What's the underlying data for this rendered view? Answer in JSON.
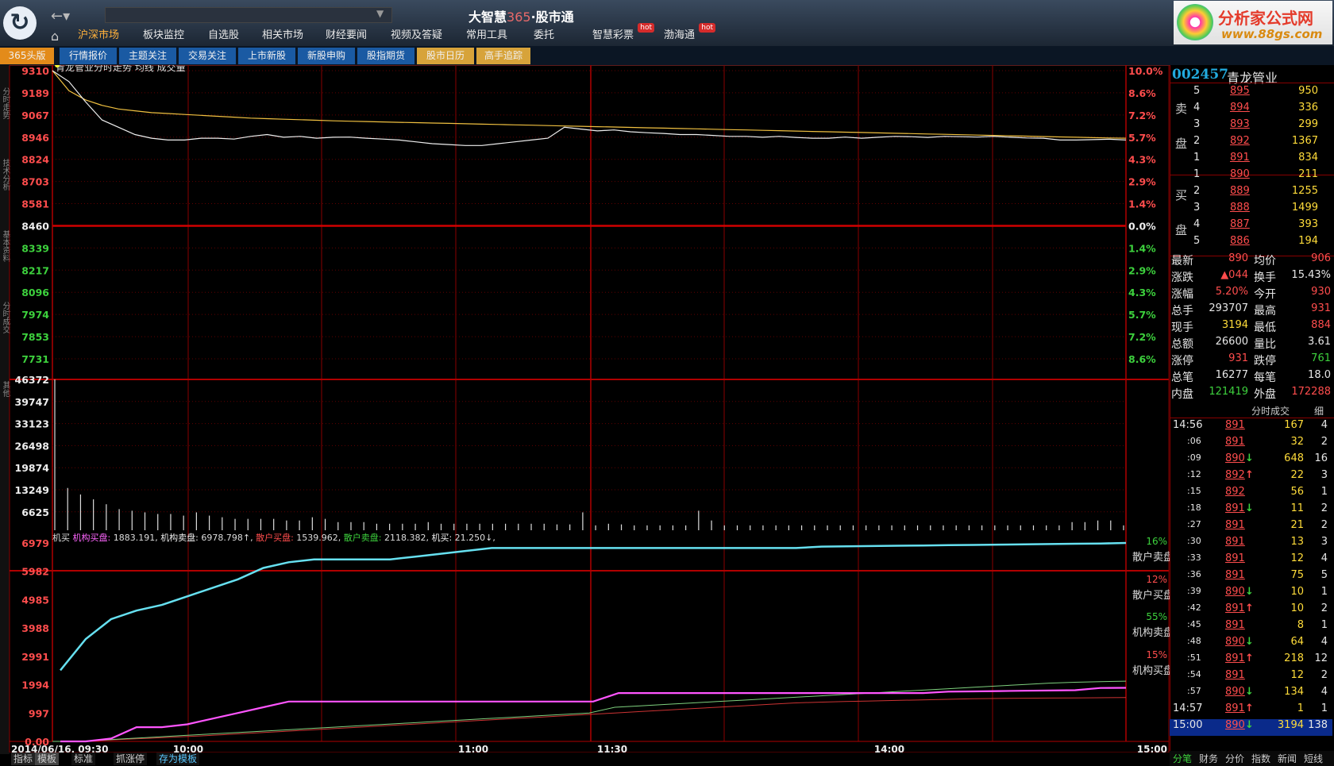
{
  "app": {
    "title_a": "大智慧",
    "title_b": "365",
    "title_c": "·",
    "title_d": "股市通",
    "back_icon": "arrow-left-icon",
    "home_icon": "home-icon"
  },
  "top_menu": [
    {
      "label": "沪深市场",
      "active": true
    },
    {
      "label": "板块监控"
    },
    {
      "label": "自选股"
    },
    {
      "label": "相关市场"
    },
    {
      "label": "财经要闻"
    },
    {
      "label": "视频及答疑"
    },
    {
      "label": "常用工具"
    },
    {
      "label": "委托"
    },
    {
      "label": "智慧彩票",
      "hot": "hot"
    },
    {
      "label": "渤海通",
      "hot": "hot"
    }
  ],
  "brand": {
    "name": "分析家公式网",
    "url": "www.88gs.com"
  },
  "sub_tabs": [
    {
      "label": "365头版",
      "style": "orange"
    },
    {
      "label": "行情报价"
    },
    {
      "label": "主题关注"
    },
    {
      "label": "交易关注"
    },
    {
      "label": "上市新股"
    },
    {
      "label": "新股申购"
    },
    {
      "label": "股指期货"
    },
    {
      "label": "股市日历",
      "style": "gold"
    },
    {
      "label": "高手追踪",
      "style": "gold"
    }
  ],
  "left_tabs": [
    "分时走势",
    "技术分析",
    "基本资料",
    "分时成交",
    "其他"
  ],
  "chart_header": {
    "text": "青龙管业分时走势 均线 成交量"
  },
  "chart_data": [
    {
      "type": "line",
      "name_key": "price",
      "y_ticks": [
        "9310",
        "9189",
        "9067",
        "8946",
        "8824",
        "8703",
        "8581",
        "8460",
        "8339",
        "8217",
        "8096",
        "7974",
        "7853",
        "7731"
      ],
      "pct_ticks": [
        "10.0%",
        "8.6%",
        "7.2%",
        "5.7%",
        "4.3%",
        "2.9%",
        "1.4%",
        "0.0%",
        "1.4%",
        "2.9%",
        "4.3%",
        "5.7%",
        "7.2%",
        "8.6%"
      ],
      "base": 8460,
      "x_labels": [
        "2014/06/16, 09:30",
        "10:00",
        "11:00",
        "11:30",
        "14:00",
        "15:00"
      ],
      "price": [
        9310,
        9250,
        9140,
        9040,
        9000,
        8960,
        8940,
        8930,
        8930,
        8940,
        8940,
        8935,
        8950,
        8960,
        8945,
        8950,
        8940,
        8945,
        8946,
        8940,
        8935,
        8930,
        8920,
        8910,
        8905,
        8900,
        8900,
        8910,
        8920,
        8930,
        8940,
        9000,
        8990,
        8980,
        8985,
        8975,
        8970,
        8966,
        8960,
        8960,
        8955,
        8950,
        8950,
        8945,
        8950,
        8944,
        8940,
        8940,
        8946,
        8940,
        8945,
        8950,
        8948,
        8944,
        8950,
        8948,
        8946,
        8950,
        8945,
        8941,
        8940,
        8930,
        8930,
        8932,
        8934,
        8930
      ],
      "avg": [
        9310,
        9200,
        9150,
        9120,
        9100,
        9090,
        9080,
        9075,
        9070,
        9065,
        9060,
        9055,
        9050,
        9047,
        9044,
        9041,
        9038,
        9035,
        9033,
        9031,
        9029,
        9027,
        9025,
        9023,
        9021,
        9019,
        9017,
        9015,
        9013,
        9011,
        9009,
        9007,
        9005,
        9003,
        9001,
        8999,
        8997,
        8995,
        8993,
        8991,
        8989,
        8987,
        8985,
        8983,
        8981,
        8979,
        8977,
        8975,
        8973,
        8971,
        8969,
        8967,
        8965,
        8963,
        8961,
        8959,
        8957,
        8955,
        8953,
        8951,
        8949,
        8947,
        8945,
        8943,
        8941,
        8940
      ]
    },
    {
      "type": "bar",
      "name_key": "volume",
      "y_ticks": [
        "46372",
        "39747",
        "33123",
        "26498",
        "19874",
        "13249",
        "6625"
      ],
      "ymax": 46372,
      "values": [
        46372,
        13000,
        11000,
        9500,
        8000,
        6500,
        6000,
        5500,
        5000,
        5000,
        4500,
        5500,
        4500,
        4000,
        3500,
        3500,
        3500,
        3500,
        3000,
        3000,
        4000,
        3500,
        2500,
        2500,
        2500,
        2000,
        2000,
        2000,
        2000,
        2500,
        2000,
        2000,
        2000,
        2000,
        2000,
        2000,
        2000,
        2000,
        2000,
        1800,
        1800,
        5500,
        1500,
        2000,
        1800,
        1500,
        1500,
        1500,
        1500,
        1500,
        6000,
        3000,
        1500,
        1500,
        1500,
        1500,
        1500,
        1500,
        1500,
        1500,
        1500,
        1500,
        1500,
        1500,
        1500,
        1500,
        1500,
        1500,
        1500,
        1500,
        1500,
        1500,
        1500,
        1500,
        1500,
        1500,
        1500,
        1500,
        1500,
        2500,
        2500,
        3000,
        3000,
        1500
      ]
    },
    {
      "type": "line",
      "name_key": "flow",
      "legend": {
        "label0": "机买",
        "label1": "机构买盘:",
        "value1": "1883.191,",
        "label2": "机构卖盘:",
        "value2": "6978.798↑,",
        "label3": "散户买盘:",
        "value3": "1539.962,",
        "label4": "散户卖盘:",
        "value4": "2118.382,",
        "label5": "机买:",
        "value5": "21.250↓,"
      },
      "y_ticks": [
        "6979",
        "5982",
        "4985",
        "3988",
        "2991",
        "1994",
        "997",
        "0.00"
      ],
      "ymax": 6979,
      "right_labels": [
        {
          "pct": "16%",
          "name": "散户卖盘"
        },
        {
          "pct": "12%",
          "name": "散户买盘"
        },
        {
          "pct": "55%",
          "name": "机构卖盘"
        },
        {
          "pct": "15%",
          "name": "机构买盘"
        }
      ],
      "series_inst_sell": [
        2500,
        3600,
        4300,
        4600,
        4800,
        5100,
        5400,
        5700,
        6100,
        6300,
        6400,
        6400,
        6400,
        6400,
        6500,
        6600,
        6700,
        6800,
        6800,
        6800,
        6800,
        6800,
        6800,
        6800,
        6800,
        6800,
        6800,
        6800,
        6800,
        6800,
        6850,
        6860,
        6870,
        6880,
        6890,
        6900,
        6910,
        6920,
        6930,
        6940,
        6950,
        6960,
        6979
      ],
      "series_inst_buy": [
        0,
        0,
        100,
        500,
        500,
        600,
        800,
        1000,
        1200,
        1400,
        1400,
        1400,
        1400,
        1400,
        1400,
        1400,
        1400,
        1400,
        1400,
        1400,
        1400,
        1400,
        1700,
        1700,
        1700,
        1700,
        1700,
        1700,
        1700,
        1700,
        1700,
        1700,
        1700,
        1700,
        1700,
        1750,
        1760,
        1770,
        1780,
        1790,
        1800,
        1880,
        1883
      ],
      "series_retail_sell": [
        0,
        0,
        50,
        100,
        150,
        200,
        250,
        300,
        350,
        400,
        450,
        500,
        550,
        600,
        650,
        700,
        750,
        800,
        850,
        900,
        950,
        1000,
        1200,
        1250,
        1300,
        1350,
        1400,
        1450,
        1500,
        1550,
        1600,
        1650,
        1700,
        1750,
        1800,
        1850,
        1900,
        1950,
        2000,
        2050,
        2080,
        2100,
        2118
      ],
      "series_retail_buy": [
        0,
        0,
        40,
        80,
        120,
        160,
        200,
        250,
        300,
        350,
        400,
        450,
        500,
        550,
        600,
        650,
        700,
        750,
        800,
        850,
        900,
        950,
        1000,
        1050,
        1100,
        1150,
        1200,
        1250,
        1300,
        1350,
        1380,
        1400,
        1420,
        1440,
        1460,
        1480,
        1500,
        1510,
        1520,
        1525,
        1530,
        1535,
        1540
      ]
    }
  ],
  "right": {
    "code": "002457",
    "name": "青龙管业",
    "sell_label_a": "卖",
    "sell_label_b": "盘",
    "buy_label_a": "买",
    "buy_label_b": "盘",
    "asks": [
      {
        "lvl": "5",
        "price": "895",
        "vol": "950"
      },
      {
        "lvl": "4",
        "price": "894",
        "vol": "336"
      },
      {
        "lvl": "3",
        "price": "893",
        "vol": "299"
      },
      {
        "lvl": "2",
        "price": "892",
        "vol": "1367"
      },
      {
        "lvl": "1",
        "price": "891",
        "vol": "834"
      }
    ],
    "bids": [
      {
        "lvl": "1",
        "price": "890",
        "vol": "211"
      },
      {
        "lvl": "2",
        "price": "889",
        "vol": "1255"
      },
      {
        "lvl": "3",
        "price": "888",
        "vol": "1499"
      },
      {
        "lvl": "4",
        "price": "887",
        "vol": "393"
      },
      {
        "lvl": "5",
        "price": "886",
        "vol": "194"
      }
    ],
    "quote": [
      {
        "k1": "最新",
        "v1": "890",
        "c1": "red",
        "k2": "均价",
        "v2": "906",
        "c2": "red"
      },
      {
        "k1": "涨跌",
        "v1": "▲044",
        "c1": "red",
        "k2": "换手",
        "v2": "15.43%",
        "c2": "white"
      },
      {
        "k1": "涨幅",
        "v1": "5.20%",
        "c1": "red",
        "k2": "今开",
        "v2": "930",
        "c2": "red"
      },
      {
        "k1": "总手",
        "v1": "293707",
        "c1": "white",
        "k2": "最高",
        "v2": "931",
        "c2": "red"
      },
      {
        "k1": "现手",
        "v1": "3194",
        "c1": "yellow",
        "k2": "最低",
        "v2": "884",
        "c2": "red"
      },
      {
        "k1": "总额",
        "v1": "26600",
        "c1": "white",
        "k2": "量比",
        "v2": "3.61",
        "c2": "white"
      },
      {
        "k1": "涨停",
        "v1": "931",
        "c1": "red",
        "k2": "跌停",
        "v2": "761",
        "c2": "green"
      },
      {
        "k1": "总笔",
        "v1": "16277",
        "c1": "white",
        "k2": "每笔",
        "v2": "18.0",
        "c2": "white"
      },
      {
        "k1": "内盘",
        "v1": "121419",
        "c1": "green",
        "k2": "外盘",
        "v2": "172288",
        "c2": "red"
      }
    ],
    "ticks_title": "分时成交",
    "ticks_detail": "细",
    "ticks": [
      {
        "t": "14:56",
        "p": "891",
        "a": "",
        "v": "167",
        "n": "4"
      },
      {
        "t": ":06",
        "p": "891",
        "a": "",
        "v": "32",
        "n": "2"
      },
      {
        "t": ":09",
        "p": "890",
        "a": "↓",
        "v": "648",
        "n": "16"
      },
      {
        "t": ":12",
        "p": "892",
        "a": "↑",
        "v": "22",
        "n": "3"
      },
      {
        "t": ":15",
        "p": "892",
        "a": "",
        "v": "56",
        "n": "1"
      },
      {
        "t": ":18",
        "p": "891",
        "a": "↓",
        "v": "11",
        "n": "2"
      },
      {
        "t": ":27",
        "p": "891",
        "a": "",
        "v": "21",
        "n": "2"
      },
      {
        "t": ":30",
        "p": "891",
        "a": "",
        "v": "13",
        "n": "3"
      },
      {
        "t": ":33",
        "p": "891",
        "a": "",
        "v": "12",
        "n": "4"
      },
      {
        "t": ":36",
        "p": "891",
        "a": "",
        "v": "75",
        "n": "5"
      },
      {
        "t": ":39",
        "p": "890",
        "a": "↓",
        "v": "10",
        "n": "1"
      },
      {
        "t": ":42",
        "p": "891",
        "a": "↑",
        "v": "10",
        "n": "2"
      },
      {
        "t": ":45",
        "p": "891",
        "a": "",
        "v": "8",
        "n": "1"
      },
      {
        "t": ":48",
        "p": "890",
        "a": "↓",
        "v": "64",
        "n": "4"
      },
      {
        "t": ":51",
        "p": "891",
        "a": "↑",
        "v": "218",
        "n": "12"
      },
      {
        "t": ":54",
        "p": "891",
        "a": "",
        "v": "12",
        "n": "2"
      },
      {
        "t": ":57",
        "p": "890",
        "a": "↓",
        "v": "134",
        "n": "4"
      },
      {
        "t": "14:57",
        "p": "891",
        "a": "↑",
        "v": "1",
        "n": "1"
      },
      {
        "t": "15:00",
        "p": "890",
        "a": "↓",
        "v": "3194",
        "n": "138"
      }
    ],
    "bottom_tabs": [
      "分笔",
      "财务",
      "分价",
      "指数",
      "新闻",
      "短线"
    ]
  },
  "bottom_tabs": [
    "指标",
    "模板",
    "标准",
    "抓涨停",
    "存为模板"
  ]
}
